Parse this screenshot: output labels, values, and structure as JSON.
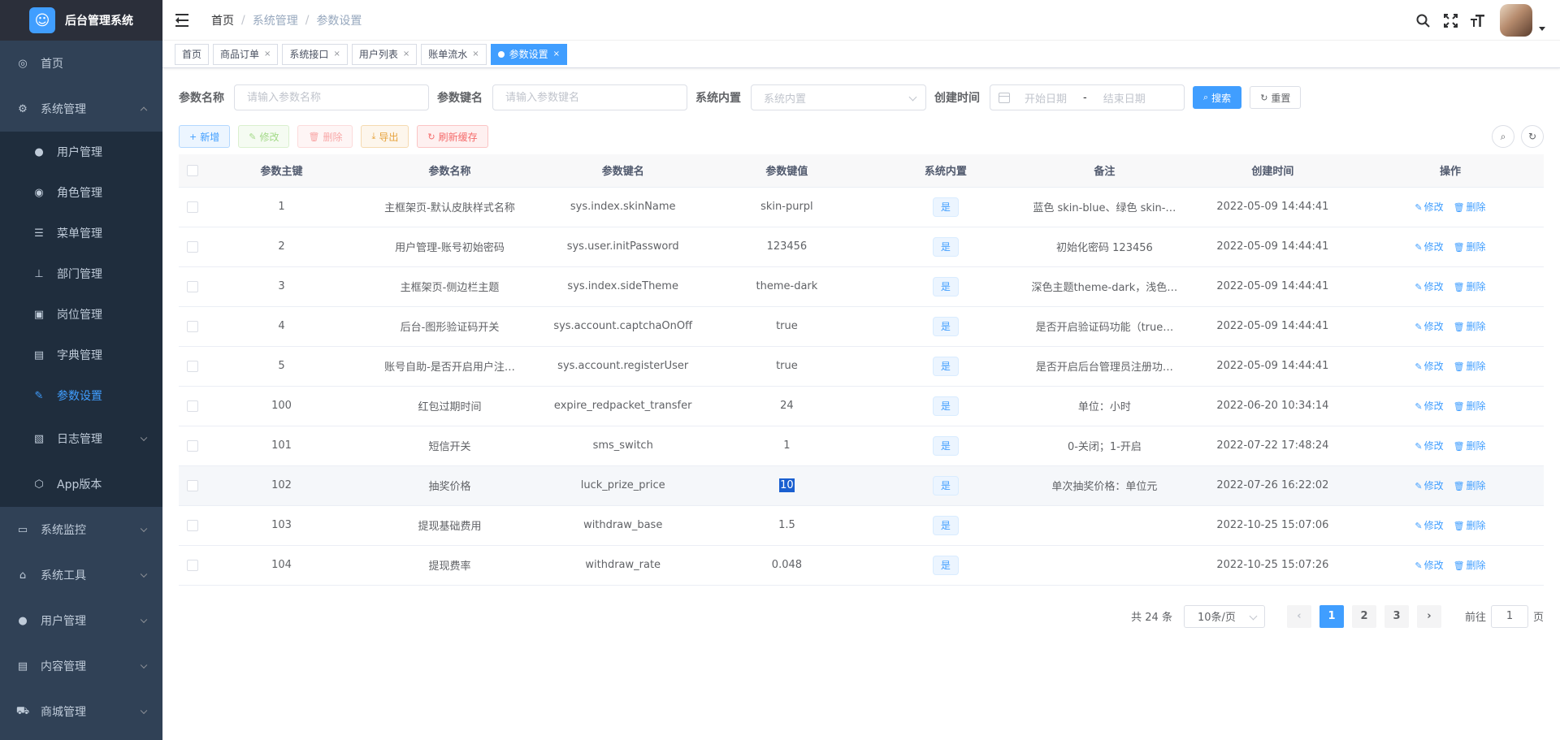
{
  "app": {
    "title": "后台管理系统",
    "logo_icon": "robot-logo"
  },
  "sidebar": {
    "items": [
      {
        "label": "首页",
        "icon": "dashboard-icon",
        "glyph": "◎"
      },
      {
        "label": "系统管理",
        "icon": "gear-icon",
        "glyph": "⚙",
        "expanded": true,
        "children": [
          {
            "label": "用户管理",
            "icon": "user-icon",
            "glyph": "●"
          },
          {
            "label": "角色管理",
            "icon": "peoples-icon",
            "glyph": "◉"
          },
          {
            "label": "菜单管理",
            "icon": "tree-table-icon",
            "glyph": "☰"
          },
          {
            "label": "部门管理",
            "icon": "tree-icon",
            "glyph": "⊥"
          },
          {
            "label": "岗位管理",
            "icon": "post-icon",
            "glyph": "▣"
          },
          {
            "label": "字典管理",
            "icon": "dict-icon",
            "glyph": "▤"
          },
          {
            "label": "参数设置",
            "icon": "edit-icon",
            "glyph": "✎",
            "active": true
          },
          {
            "label": "日志管理",
            "icon": "log-icon",
            "glyph": "▧",
            "has_children": true
          },
          {
            "label": "App版本",
            "icon": "cube-icon",
            "glyph": "⬡"
          }
        ]
      },
      {
        "label": "系统监控",
        "icon": "monitor-icon",
        "glyph": "▭"
      },
      {
        "label": "系统工具",
        "icon": "tool-icon",
        "glyph": "⌂"
      },
      {
        "label": "用户管理",
        "icon": "user-icon",
        "glyph": "●"
      },
      {
        "label": "内容管理",
        "icon": "document-icon",
        "glyph": "▤"
      },
      {
        "label": "商城管理",
        "icon": "shopping-cart-icon",
        "glyph": "⛟"
      }
    ]
  },
  "navbar": {
    "breadcrumb": [
      "首页",
      "系统管理",
      "参数设置"
    ],
    "breadcrumb_sep": "/"
  },
  "tags": [
    {
      "label": "首页",
      "closable": false
    },
    {
      "label": "商品订单",
      "closable": true
    },
    {
      "label": "系统接口",
      "closable": true
    },
    {
      "label": "用户列表",
      "closable": true
    },
    {
      "label": "账单流水",
      "closable": true
    },
    {
      "label": "参数设置",
      "closable": true,
      "active": true
    }
  ],
  "search": {
    "config_name_label": "参数名称",
    "config_name_placeholder": "请输入参数名称",
    "config_key_label": "参数键名",
    "config_key_placeholder": "请输入参数键名",
    "config_type_label": "系统内置",
    "config_type_placeholder": "系统内置",
    "create_time_label": "创建时间",
    "start_placeholder": "开始日期",
    "range_sep": "-",
    "end_placeholder": "结束日期",
    "search_btn": "搜索",
    "reset_btn": "重置"
  },
  "toolbar": {
    "add": "新增",
    "edit": "修改",
    "delete": "删除",
    "export": "导出",
    "refresh_cache": "刷新缓存"
  },
  "table": {
    "columns": [
      "参数主键",
      "参数名称",
      "参数键名",
      "参数键值",
      "系统内置",
      "备注",
      "创建时间",
      "操作"
    ],
    "edit_label": "修改",
    "delete_label": "删除",
    "rows": [
      {
        "id": "1",
        "name": "主框架页-默认皮肤样式名称",
        "key": "sys.index.skinName",
        "value": "skin-purpl",
        "builtin": "是",
        "remark": "蓝色 skin-blue、绿色 skin-…",
        "time": "2022-05-09 14:44:41"
      },
      {
        "id": "2",
        "name": "用户管理-账号初始密码",
        "key": "sys.user.initPassword",
        "value": "123456",
        "builtin": "是",
        "remark": "初始化密码 123456",
        "time": "2022-05-09 14:44:41"
      },
      {
        "id": "3",
        "name": "主框架页-侧边栏主题",
        "key": "sys.index.sideTheme",
        "value": "theme-dark",
        "builtin": "是",
        "remark": "深色主题theme-dark，浅色…",
        "time": "2022-05-09 14:44:41"
      },
      {
        "id": "4",
        "name": "后台-图形验证码开关",
        "key": "sys.account.captchaOnOff",
        "value": "true",
        "builtin": "是",
        "remark": "是否开启验证码功能（true…",
        "time": "2022-05-09 14:44:41"
      },
      {
        "id": "5",
        "name": "账号自助-是否开启用户注…",
        "key": "sys.account.registerUser",
        "value": "true",
        "builtin": "是",
        "remark": "是否开启后台管理员注册功…",
        "time": "2022-05-09 14:44:41"
      },
      {
        "id": "100",
        "name": "红包过期时间",
        "key": "expire_redpacket_transfer",
        "value": "24",
        "builtin": "是",
        "remark": "单位：小时",
        "time": "2022-06-20 10:34:14"
      },
      {
        "id": "101",
        "name": "短信开关",
        "key": "sms_switch",
        "value": "1",
        "builtin": "是",
        "remark": "0-关闭；1-开启",
        "time": "2022-07-22 17:48:24"
      },
      {
        "id": "102",
        "name": "抽奖价格",
        "key": "luck_prize_price",
        "value": "10",
        "builtin": "是",
        "remark": "单次抽奖价格：单位元",
        "time": "2022-07-26 16:22:02",
        "hover": true,
        "value_selected": true
      },
      {
        "id": "103",
        "name": "提现基础费用",
        "key": "withdraw_base",
        "value": "1.5",
        "builtin": "是",
        "remark": "",
        "time": "2022-10-25 15:07:06"
      },
      {
        "id": "104",
        "name": "提现费率",
        "key": "withdraw_rate",
        "value": "0.048",
        "builtin": "是",
        "remark": "",
        "time": "2022-10-25 15:07:26"
      }
    ]
  },
  "pagination": {
    "total": "共 24 条",
    "page_size": "10条/页",
    "pages": [
      "1",
      "2",
      "3"
    ],
    "current": "1",
    "goto_label": "前往",
    "goto_value": "1",
    "goto_suffix": "页"
  },
  "colors": {
    "primary": "#409eff",
    "sidebar_bg": "#304156",
    "submenu_bg": "#1f2d3d"
  }
}
